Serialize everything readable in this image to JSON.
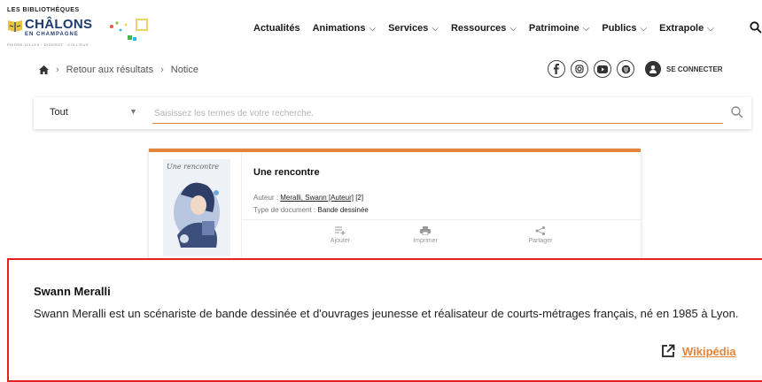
{
  "logo": {
    "top": "LES BIBLIOTHÈQUES",
    "main": "CHÂLONS",
    "sub": "EN CHAMPAGNE",
    "tag": "PIERRE-GILLES · DIDEROT · COLLIEUX"
  },
  "nav": {
    "items": [
      {
        "label": "Actualités",
        "chevron": false
      },
      {
        "label": "Animations",
        "chevron": true
      },
      {
        "label": "Services",
        "chevron": true
      },
      {
        "label": "Ressources",
        "chevron": true
      },
      {
        "label": "Patrimoine",
        "chevron": true
      },
      {
        "label": "Publics",
        "chevron": true
      },
      {
        "label": "Extrapole",
        "chevron": true
      }
    ],
    "search_icon": "search-icon"
  },
  "breadcrumb": {
    "home_icon": "home-icon",
    "items": [
      "Retour aux résultats",
      "Notice"
    ]
  },
  "social": {
    "icons": [
      "facebook-icon",
      "instagram-icon",
      "youtube-icon",
      "podcast-icon"
    ],
    "connect_label": "SE CONNECTER"
  },
  "search": {
    "scope": "Tout",
    "placeholder": "Saisissez les termes de votre recherche."
  },
  "record": {
    "cover_text": "Une rencontre",
    "title": "Une rencontre",
    "author_label": "Auteur :",
    "author_value": "Meralli, Swann [Auteur]",
    "author_count": "[2]",
    "type_label": "Type de document :",
    "type_value": "Bande dessinée",
    "accent_color": "#e2843a",
    "actions": [
      {
        "label": "Ajouter",
        "icon": "add-list-icon"
      },
      {
        "label": "Imprimer",
        "icon": "printer-icon"
      },
      {
        "label": "Partager",
        "icon": "share-icon"
      }
    ]
  },
  "popup": {
    "name": "Swann Meralli",
    "bio": "Swann Meralli est un scénariste de bande dessinée et d'ouvrages jeunesse et réalisateur de courts-métrages français, né en 1985 à Lyon.",
    "link_label": "Wikipédia",
    "border_color": "#e52222"
  }
}
